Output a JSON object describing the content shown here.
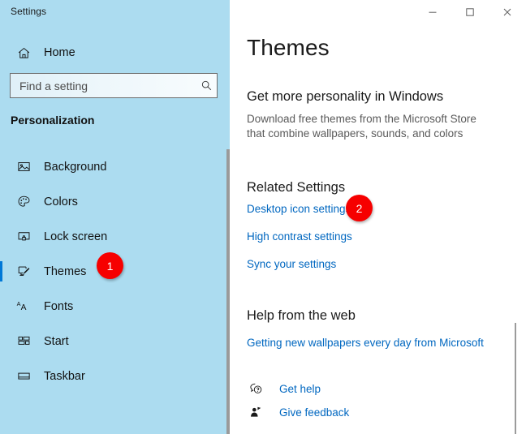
{
  "window": {
    "app_title": "Settings",
    "controls": [
      {
        "name": "minimize",
        "glyph": "–"
      },
      {
        "name": "maximize",
        "glyph": "□"
      },
      {
        "name": "close",
        "glyph": "✕"
      }
    ]
  },
  "sidebar": {
    "home_label": "Home",
    "home_icon": "home-icon",
    "search": {
      "placeholder": "Find a setting",
      "value": "",
      "icon": "search-icon"
    },
    "category": "Personalization",
    "accent_color": "#0078D7",
    "background_color": "#ACDCF0",
    "items": [
      {
        "label": "Background",
        "icon": "picture-icon",
        "selected": false
      },
      {
        "label": "Colors",
        "icon": "palette-icon",
        "selected": false
      },
      {
        "label": "Lock screen",
        "icon": "lock-screen-icon",
        "selected": false
      },
      {
        "label": "Themes",
        "icon": "themes-brush-icon",
        "selected": true
      },
      {
        "label": "Fonts",
        "icon": "fonts-aa-icon",
        "selected": false
      },
      {
        "label": "Start",
        "icon": "start-tiles-icon",
        "selected": false
      },
      {
        "label": "Taskbar",
        "icon": "taskbar-icon",
        "selected": false
      }
    ]
  },
  "main": {
    "page_title": "Themes",
    "personality": {
      "heading": "Get more personality in Windows",
      "body": "Download free themes from the Microsoft Store that combine wallpapers, sounds, and colors"
    },
    "related_settings": {
      "heading": "Related Settings",
      "links": [
        "Desktop icon settings",
        "High contrast settings",
        "Sync your settings"
      ]
    },
    "help_from_web": {
      "heading": "Help from the web",
      "link": "Getting new wallpapers every day from Microsoft",
      "actions": [
        {
          "label": "Get help",
          "icon": "help-question-bubble-icon"
        },
        {
          "label": "Give feedback",
          "icon": "feedback-person-icon"
        }
      ]
    },
    "link_color": "#0067C0"
  },
  "callouts": [
    {
      "number": "1",
      "target": "themes-sidebar-item",
      "color": "#F60000"
    },
    {
      "number": "2",
      "target": "desktop-icon-settings-link",
      "color": "#F60000"
    }
  ]
}
